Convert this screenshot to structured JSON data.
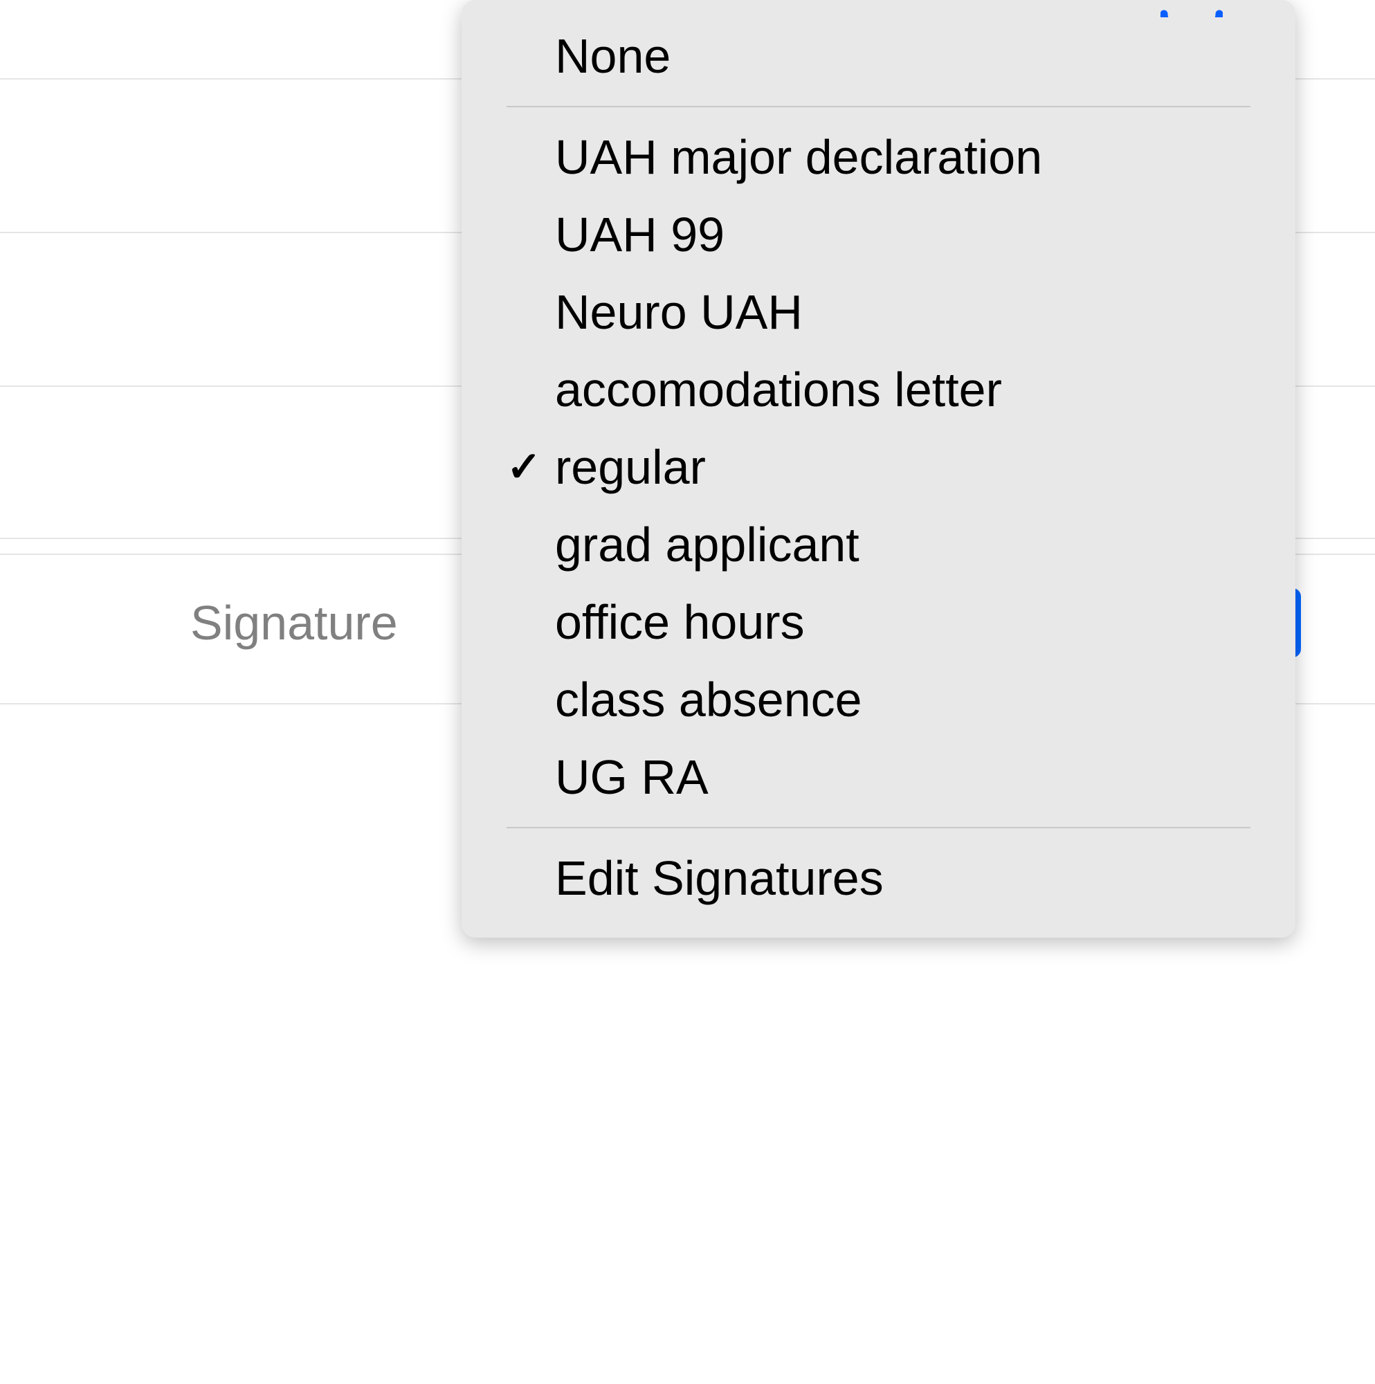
{
  "form": {
    "signature_label": "Signature"
  },
  "dropdown": {
    "none_label": "None",
    "items": [
      {
        "label": "UAH major declaration",
        "checked": false
      },
      {
        "label": "UAH 99",
        "checked": false
      },
      {
        "label": "Neuro UAH",
        "checked": false
      },
      {
        "label": "accomodations letter",
        "checked": false
      },
      {
        "label": "regular",
        "checked": true
      },
      {
        "label": "grad applicant",
        "checked": false
      },
      {
        "label": "office hours",
        "checked": false
      },
      {
        "label": "class absence",
        "checked": false
      },
      {
        "label": "UG RA",
        "checked": false
      }
    ],
    "edit_label": "Edit Signatures",
    "checkmark_glyph": "✓"
  }
}
